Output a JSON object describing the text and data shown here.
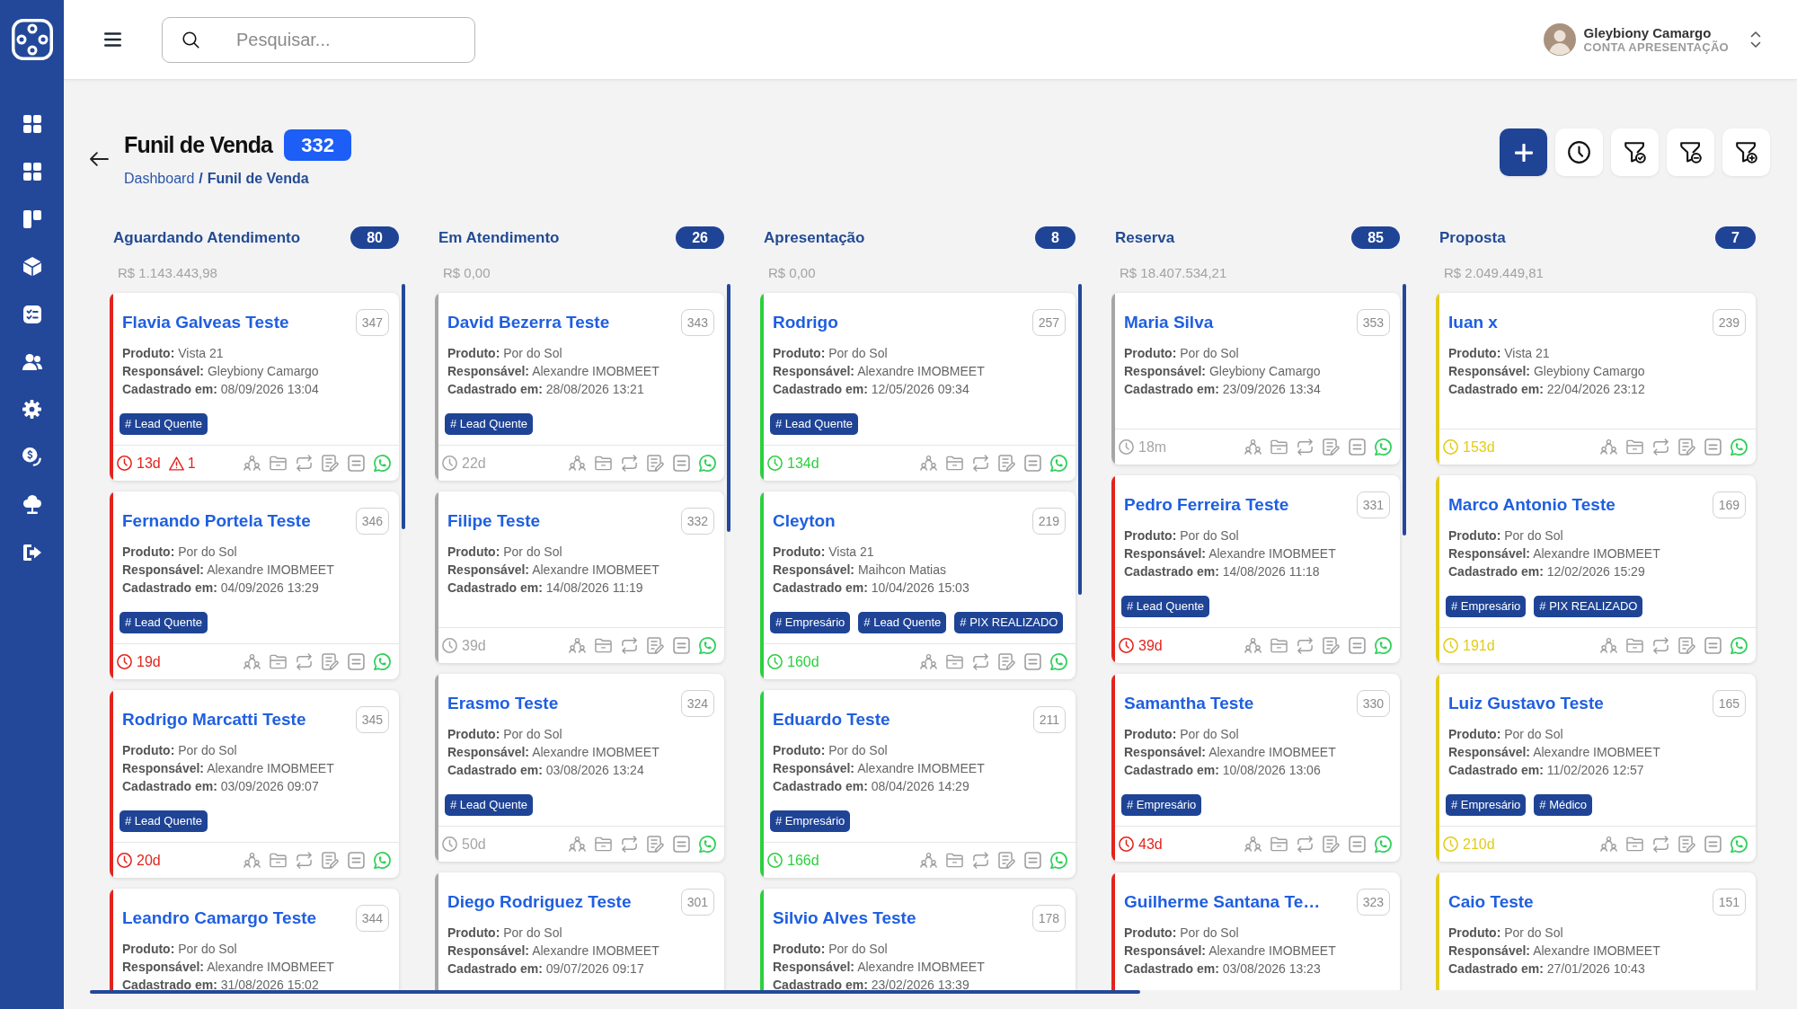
{
  "topbar": {
    "search": {
      "placeholder": "Pesquisar..."
    },
    "user": {
      "name": "Gleybiony Camargo",
      "account": "CONTA APRESENTAÇÃO"
    }
  },
  "header": {
    "title": "Funil de Venda",
    "count": "332",
    "breadcrumb": {
      "items": [
        "Dashboard",
        "Funil de Venda"
      ],
      "separator": "/"
    }
  },
  "columns": [
    {
      "title": "Aguardando Atendimento",
      "count": "80",
      "total": "R$ 1.143.443,98",
      "cards": [
        {
          "name": "Flavia Galveas Teste",
          "id": "347",
          "details": [
            "**Produto:** Vista 21",
            "**Responsável:** Gleybiony Camargo",
            "**Cadastrado em:** 08/09/2026 13:04"
          ],
          "tags": [
            "# Lead Quente"
          ],
          "time": "13d",
          "alerts": "1",
          "color": "#e3241c"
        },
        {
          "name": "Fernando Portela Teste",
          "id": "346",
          "details": [
            "**Produto:** Por do Sol",
            "**Responsável:** Alexandre IMOBMEET",
            "**Cadastrado em:** 04/09/2026 13:29"
          ],
          "tags": [
            "# Lead Quente"
          ],
          "time": "19d",
          "color": "#e3241c"
        },
        {
          "name": "Rodrigo Marcatti Teste",
          "id": "345",
          "details": [
            "**Produto:** Por do Sol",
            "**Responsável:** Alexandre IMOBMEET",
            "**Cadastrado em:** 03/09/2026 09:07"
          ],
          "tags": [
            "# Lead Quente"
          ],
          "time": "20d",
          "color": "#e3241c"
        },
        {
          "name": "Leandro Camargo Teste",
          "id": "344",
          "details": [
            "**Produto:** Por do Sol",
            "**Responsável:** Alexandre IMOBMEET",
            "**Cadastrado em:** 31/08/2026 15:02"
          ],
          "color": "#e3241c"
        }
      ]
    },
    {
      "title": "Em Atendimento",
      "count": "26",
      "total": "R$ 0,00",
      "cards": [
        {
          "name": "David Bezerra Teste",
          "id": "343",
          "details": [
            "**Produto:** Por do Sol",
            "**Responsável:** Alexandre IMOBMEET",
            "**Cadastrado em:** 28/08/2026 13:21"
          ],
          "tags": [
            "# Lead Quente"
          ],
          "time": "22d",
          "color": "#a6a6a6"
        },
        {
          "name": "Filipe Teste",
          "id": "332",
          "details": [
            "**Produto:** Por do Sol",
            "**Responsável:** Alexandre IMOBMEET",
            "**Cadastrado em:** 14/08/2026 11:19"
          ],
          "time": "39d",
          "color": "#a6a6a6"
        },
        {
          "name": "Erasmo Teste",
          "id": "324",
          "details": [
            "**Produto:** Por do Sol",
            "**Responsável:** Alexandre IMOBMEET",
            "**Cadastrado em:** 03/08/2026 13:24"
          ],
          "tags": [
            "# Lead Quente"
          ],
          "time": "50d",
          "color": "#a6a6a6"
        },
        {
          "name": "Diego Rodriguez Teste",
          "id": "301",
          "details": [
            "**Produto:** Por do Sol",
            "**Responsável:** Alexandre IMOBMEET",
            "**Cadastrado em:** 09/07/2026 09:17"
          ],
          "color": "#a6a6a6"
        }
      ]
    },
    {
      "title": "Apresentação",
      "count": "8",
      "total": "R$ 0,00",
      "cards": [
        {
          "name": "Rodrigo",
          "id": "257",
          "details": [
            "**Produto:** Por do Sol",
            "**Responsável:** Alexandre IMOBMEET",
            "**Cadastrado em:** 12/05/2026 09:34"
          ],
          "tags": [
            "# Lead Quente"
          ],
          "time": "134d",
          "color": "#2ccf3f"
        },
        {
          "name": "Cleyton",
          "id": "219",
          "details": [
            "**Produto:** Vista 21",
            "**Responsável:** Maihcon Matias",
            "**Cadastrado em:** 10/04/2026 15:03"
          ],
          "tags": [
            "# Empresário",
            "# Lead Quente",
            "# PIX REALIZADO"
          ],
          "time": "160d",
          "color": "#2ccf3f"
        },
        {
          "name": "Eduardo Teste",
          "id": "211",
          "details": [
            "**Produto:** Por do Sol",
            "**Responsável:** Alexandre IMOBMEET",
            "**Cadastrado em:** 08/04/2026 14:29"
          ],
          "tags": [
            "# Empresário"
          ],
          "time": "166d",
          "color": "#2ccf3f"
        },
        {
          "name": "Silvio Alves Teste",
          "id": "178",
          "details": [
            "**Produto:** Por do Sol",
            "**Responsável:** Alexandre IMOBMEET",
            "**Cadastrado em:** 23/02/2026 13:39"
          ],
          "color": "#2ccf3f"
        }
      ]
    },
    {
      "title": "Reserva",
      "count": "85",
      "total": "R$ 18.407.534,21",
      "cards": [
        {
          "name": "Maria Silva",
          "id": "353",
          "details": [
            "**Produto:** Por do Sol",
            "**Responsável:** Gleybiony Camargo",
            "**Cadastrado em:** 23/09/2026 13:34"
          ],
          "time": "18m",
          "color": "#a6a6a6"
        },
        {
          "name": "Pedro Ferreira Teste",
          "id": "331",
          "details": [
            "**Produto:** Por do Sol",
            "**Responsável:** Alexandre IMOBMEET",
            "**Cadastrado em:** 14/08/2026 11:18"
          ],
          "tags": [
            "# Lead Quente"
          ],
          "time": "39d",
          "color": "#e3241c"
        },
        {
          "name": "Samantha Teste",
          "id": "330",
          "details": [
            "**Produto:** Por do Sol",
            "**Responsável:** Alexandre IMOBMEET",
            "**Cadastrado em:** 10/08/2026 13:06"
          ],
          "tags": [
            "# Empresário"
          ],
          "time": "43d",
          "color": "#e3241c"
        },
        {
          "name": "Guilherme Santana Te…",
          "id": "323",
          "details": [
            "**Produto:** Por do Sol",
            "**Responsável:** Alexandre IMOBMEET",
            "**Cadastrado em:** 03/08/2026 13:23"
          ],
          "color": "#e3241c"
        }
      ]
    },
    {
      "title": "Proposta",
      "count": "7",
      "total": "R$ 2.049.449,81",
      "cards": [
        {
          "name": "Iuan x",
          "id": "239",
          "details": [
            "**Produto:** Vista 21",
            "**Responsável:** Gleybiony Camargo",
            "**Cadastrado em:** 22/04/2026 23:12"
          ],
          "time": "153d",
          "color": "#e2cc1a"
        },
        {
          "name": "Marco Antonio Teste",
          "id": "169",
          "details": [
            "**Produto:** Por do Sol",
            "**Responsável:** Alexandre IMOBMEET",
            "**Cadastrado em:** 12/02/2026 15:29"
          ],
          "tags": [
            "# Empresário",
            "# PIX REALIZADO"
          ],
          "time": "191d",
          "color": "#e2cc1a"
        },
        {
          "name": "Luiz Gustavo Teste",
          "id": "165",
          "details": [
            "**Produto:** Por do Sol",
            "**Responsável:** Alexandre IMOBMEET",
            "**Cadastrado em:** 11/02/2026 12:57"
          ],
          "tags": [
            "# Empresário",
            "# Médico"
          ],
          "time": "210d",
          "color": "#e2cc1a"
        },
        {
          "name": "Caio Teste",
          "id": "151",
          "details": [
            "**Produto:** Por do Sol",
            "**Responsável:** Alexandre IMOBMEET",
            "**Cadastrado em:** 27/01/2026 10:43"
          ],
          "color": "#e2cc1a"
        }
      ]
    }
  ]
}
